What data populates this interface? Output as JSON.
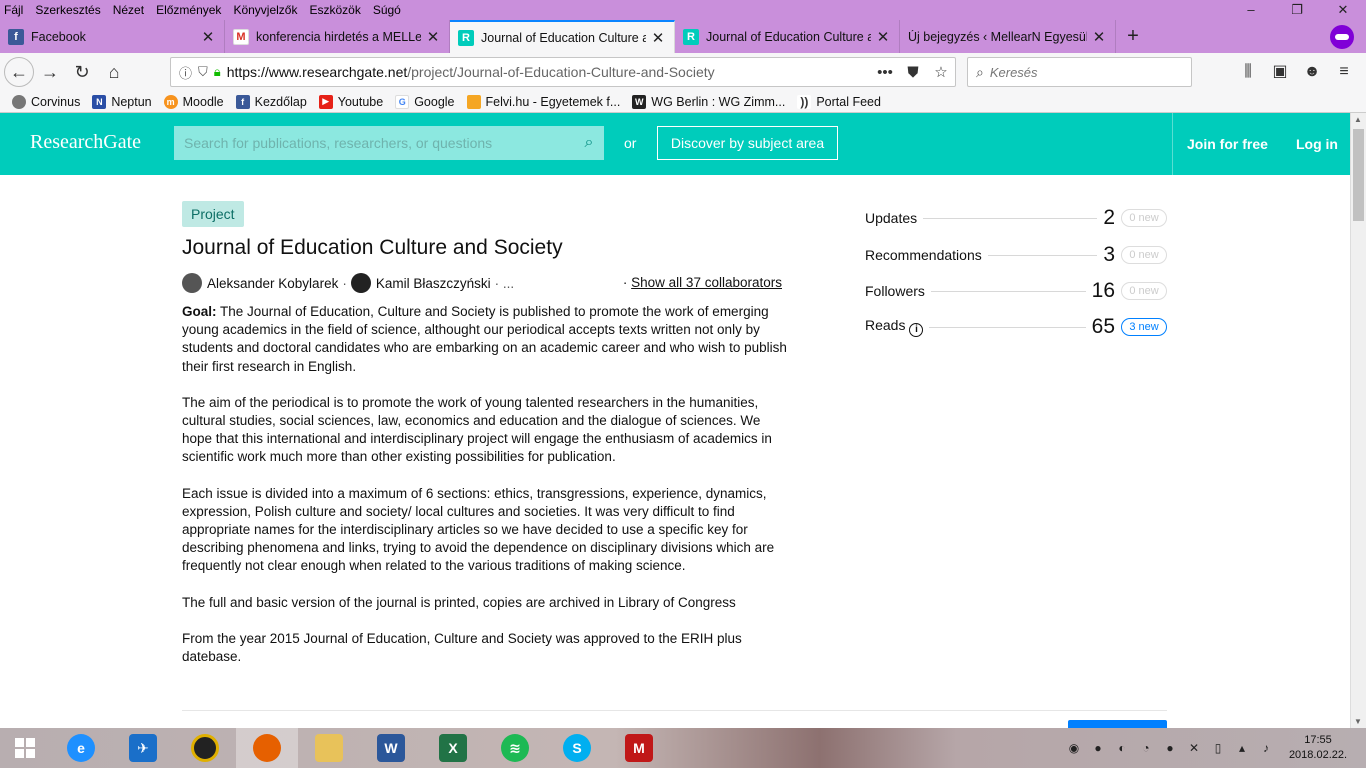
{
  "menubar": {
    "items": [
      "Fájl",
      "Szerkesztés",
      "Nézet",
      "Előzmények",
      "Könyvjelzők",
      "Eszközök",
      "Súgó"
    ]
  },
  "window_controls": {
    "minimize": "–",
    "restore": "❐",
    "close": "✕"
  },
  "tabs": [
    {
      "title": "Facebook",
      "favicon": "f",
      "active": false
    },
    {
      "title": "konferencia hirdetés a MELLearN",
      "favicon": "M",
      "active": false
    },
    {
      "title": "Journal of Education Culture and Society",
      "favicon": "R",
      "active": true
    },
    {
      "title": "Journal of Education Culture and Society",
      "favicon": "R",
      "active": false
    },
    {
      "title": "Új bejegyzés ‹ MellearN Egyesület —",
      "favicon": "",
      "active": false
    }
  ],
  "tab_close": "✕",
  "newtab_label": "+",
  "navbar": {
    "url_domain": "https://www.researchgate.net",
    "url_path": "/project/Journal-of-Education-Culture-and-Society",
    "search_placeholder": "Keresés",
    "page_actions": "•••"
  },
  "bookmarks": [
    "Corvinus",
    "Neptun",
    "Moodle",
    "Kezdőlap",
    "Youtube",
    "Google",
    "Felvi.hu - Egyetemek f...",
    "WG Berlin : WG Zimm...",
    "Portal Feed"
  ],
  "rg_header": {
    "logo": "ResearchGate",
    "search_placeholder": "Search for publications, researchers, or questions",
    "or": "or",
    "discover": "Discover by subject area",
    "join": "Join for free",
    "login": "Log in"
  },
  "project": {
    "tag": "Project",
    "title": "Journal of Education Culture and Society",
    "authors": [
      "Aleksander Kobylarek",
      "Kamil Błaszczyński"
    ],
    "author_sep": "·",
    "author_more": "· ...",
    "show_all_prefix": "·",
    "show_all": "Show all 37 collaborators",
    "goal_label": "Goal:",
    "goal_text": "The Journal of Education, Culture and Society is published to promote the work of emerging young academics in the field of science, althought our periodical accepts texts written not only by students and doctoral candidates who are embarking on an academic career and who wish to publish their first research in English.",
    "paragraphs": [
      "The aim of the periodical is to promote the work of young talented researchers in the humanities, cultural studies, social sciences, law, economics and education and the dialogue of sciences. We hope that this international and interdisciplinary project will engage the enthusiasm of academics in scientific work much more than other existing possibilities for publication.",
      "Each issue is divided into a maximum of 6 sections: ethics, transgressions, experience, dynamics, expression, Polish culture and society/ local cultures and societies. It was very difficult to find appropriate names for the interdisciplinary articles so we have decided to use a specific key for describing phenomena and links, trying to avoid the dependence on disciplinary divisions which are frequently not clear enough when related to the various traditions of making science.",
      "The full and basic version of the journal is printed, copies are archived in Library of Congress",
      "From the year 2015 Journal of Education, Culture and Society was approved to the ERIH plus datebase."
    ]
  },
  "stats": [
    {
      "label": "Updates",
      "value": "2",
      "badge": "0 new"
    },
    {
      "label": "Recommendations",
      "value": "3",
      "badge": "0 new"
    },
    {
      "label": "Followers",
      "value": "16",
      "badge": "0 new"
    },
    {
      "label": "Reads",
      "value": "65",
      "badge": "3 new"
    }
  ],
  "clock": {
    "time": "17:55",
    "date": "2018.02.22."
  }
}
